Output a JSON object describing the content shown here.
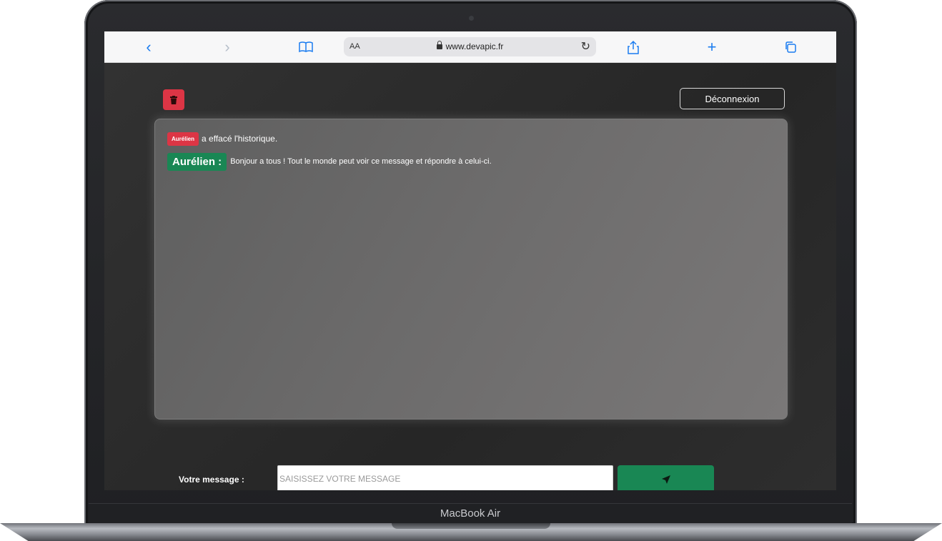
{
  "device": {
    "model_label": "MacBook Air"
  },
  "browser": {
    "text_size_label": "AA",
    "url": "www.devapic.fr",
    "icons": [
      "back-icon",
      "forward-icon",
      "bookmarks-icon",
      "lock-icon",
      "reload-icon",
      "share-icon",
      "new-tab-icon",
      "tabs-icon"
    ]
  },
  "chat": {
    "logout_label": "Déconnexion",
    "system_event": {
      "user": "Aurélien",
      "text": "a effacé l'historique."
    },
    "messages": [
      {
        "author": "Aurélien :",
        "text": "Bonjour a tous ! Tout le monde peut voir ce message et répondre à celui-ci."
      }
    ],
    "compose": {
      "label": "Votre message :",
      "placeholder": "SAISISSEZ VOTRE MESSAGE"
    },
    "colors": {
      "danger": "#dc3545",
      "success": "#198754"
    }
  }
}
